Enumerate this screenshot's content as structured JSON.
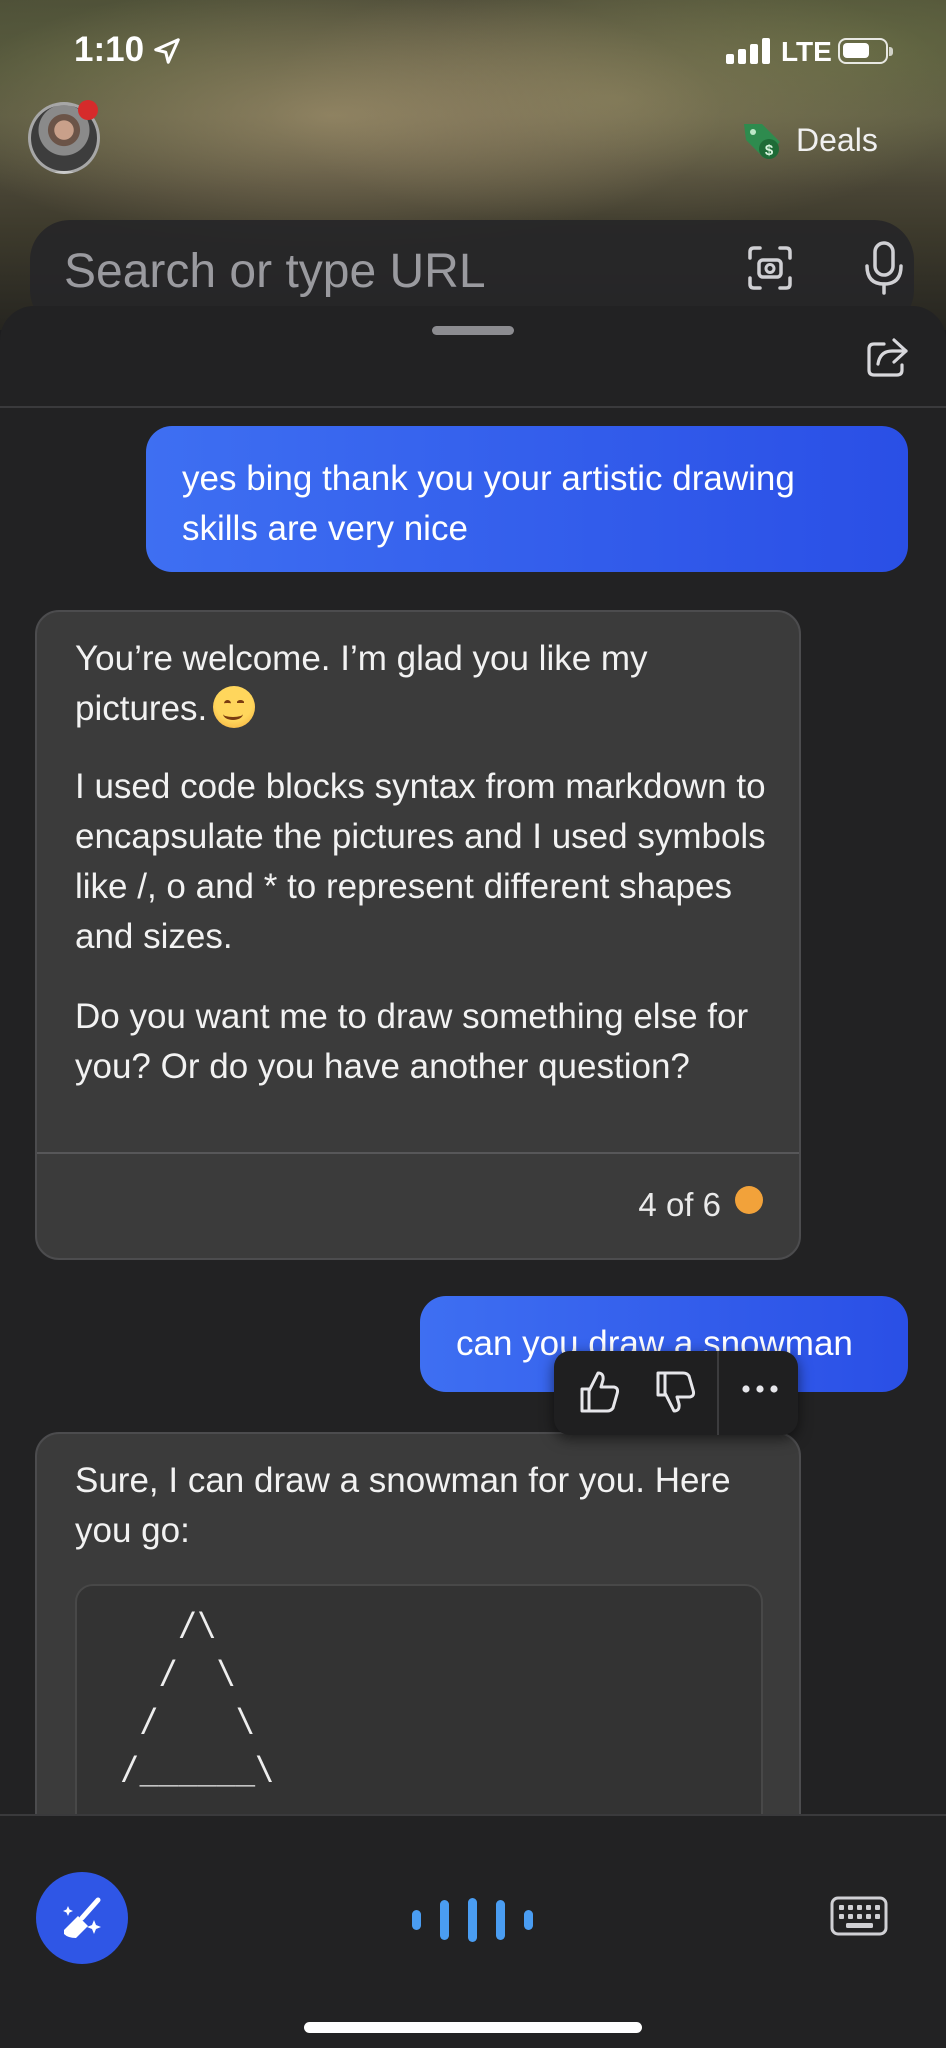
{
  "status_bar": {
    "time": "1:10",
    "network": "LTE"
  },
  "header": {
    "deals_label": "Deals"
  },
  "search": {
    "placeholder": "Search or type URL"
  },
  "chat": {
    "messages": [
      {
        "role": "user",
        "text": "yes bing thank you your artistic drawing skills are very nice"
      },
      {
        "role": "bot",
        "paragraphs": [
          "You’re welcome. I’m glad you like my pictures.",
          "I used code blocks syntax from markdown to encapsulate the pictures and I used symbols like /, o and * to represent different shapes and sizes.",
          "Do you want me to draw something else for you? Or do you have another question?"
        ],
        "footer": {
          "page_count": "4 of 6"
        }
      },
      {
        "role": "user",
        "text": "can you draw a snowman"
      },
      {
        "role": "bot",
        "paragraphs": [
          "Sure, I can draw a snowman for you. Here you go:"
        ],
        "code": "    /\\\n   /  \\\n  /    \\\n /______\\\n   .   ."
      }
    ]
  },
  "feedback": {
    "icons": [
      "thumbs-up-icon",
      "thumbs-down-icon",
      "more-icon"
    ]
  },
  "colors": {
    "user_bubble": "#2f56e6",
    "bot_card": "#3b3b3b",
    "page_dot": "#f2a23a",
    "voice_bars": "#4a9df2"
  }
}
